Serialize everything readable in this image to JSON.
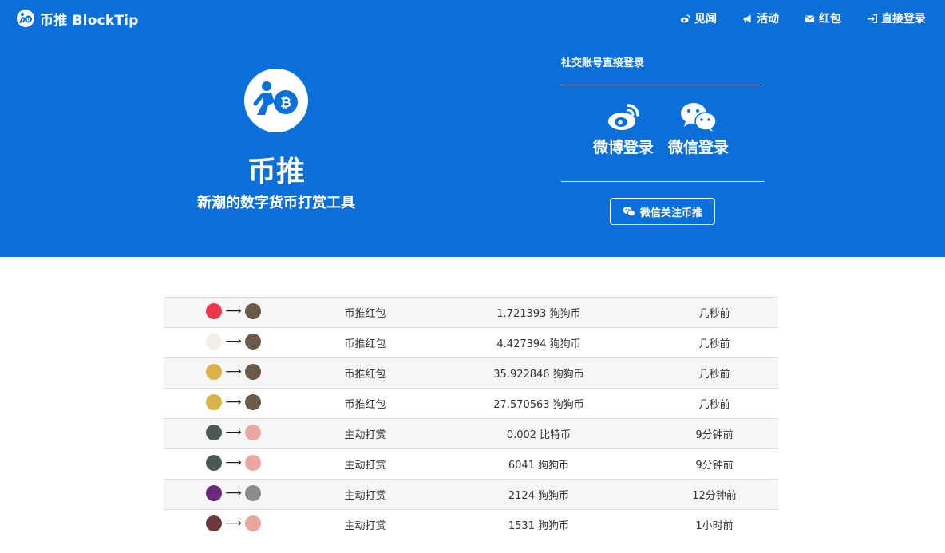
{
  "nav": {
    "brand": "币推 BlockTip",
    "links": [
      {
        "label": "见闻",
        "icon": "weibo-icon"
      },
      {
        "label": "活动",
        "icon": "bullhorn-icon"
      },
      {
        "label": "红包",
        "icon": "envelope-icon"
      },
      {
        "label": "直接登录",
        "icon": "sign-in-icon"
      }
    ]
  },
  "hero": {
    "title": "币推",
    "subtitle": "新潮的数字货币打赏工具",
    "social_title": "社交账号直接登录",
    "weibo_login": "微博登录",
    "wechat_login": "微信登录",
    "follow_button": "微信关注币推"
  },
  "colors": {
    "brand_blue": "#0a6fd9",
    "stripe": "#f6f6f6",
    "border": "#dddddd"
  },
  "feed": [
    {
      "from_avatar": "#e8384a",
      "to_avatar": "#6b5a48",
      "type": "币推红包",
      "amount": "1.721393 狗狗币",
      "time": "几秒前"
    },
    {
      "from_avatar": "#f2efe6",
      "to_avatar": "#6b5a48",
      "type": "币推红包",
      "amount": "4.427394 狗狗币",
      "time": "几秒前"
    },
    {
      "from_avatar": "#d9b24a",
      "to_avatar": "#6b5a48",
      "type": "币推红包",
      "amount": "35.922846 狗狗币",
      "time": "几秒前"
    },
    {
      "from_avatar": "#d9b24a",
      "to_avatar": "#6b5a48",
      "type": "币推红包",
      "amount": "27.570563 狗狗币",
      "time": "几秒前"
    },
    {
      "from_avatar": "#4a5a52",
      "to_avatar": "#e9a7a0",
      "type": "主动打赏",
      "amount": "0.002 比特币",
      "time": "9分钟前"
    },
    {
      "from_avatar": "#4a5a52",
      "to_avatar": "#e9a7a0",
      "type": "主动打赏",
      "amount": "6041 狗狗币",
      "time": "9分钟前"
    },
    {
      "from_avatar": "#6a2a7a",
      "to_avatar": "#8d8d8d",
      "type": "主动打赏",
      "amount": "2124 狗狗币",
      "time": "12分钟前"
    },
    {
      "from_avatar": "#6b3a3a",
      "to_avatar": "#e9a7a0",
      "type": "主动打赏",
      "amount": "1531 狗狗币",
      "time": "1小时前"
    }
  ]
}
